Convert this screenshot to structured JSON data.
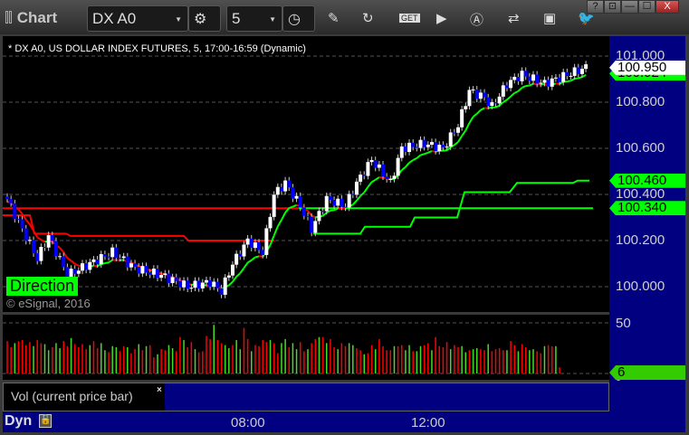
{
  "window": {
    "title": "Chart",
    "help": "?",
    "min": "—",
    "max": "☐",
    "close": "X"
  },
  "toolbar": {
    "symbol": "DX A0",
    "interval": "5",
    "icons": [
      "settings-icon",
      "clock-icon",
      "pencil-icon",
      "refresh-icon",
      "get-icon",
      "play-icon",
      "alert-icon",
      "link-icon",
      "comment-icon",
      "twitter-icon"
    ]
  },
  "chart": {
    "header": "* DX A0, US DOLLAR INDEX FUTURES, 5, 17:00-16:59 (Dynamic)",
    "direction_label": "Direction",
    "copyright": "© eSignal, 2016"
  },
  "price_axis": {
    "ticks": [
      "101.000",
      "100.800",
      "100.600",
      "100.400",
      "100.200",
      "100.000"
    ],
    "tags": {
      "last": "100.950",
      "ma": "100.924",
      "upper": "100.460",
      "lower": "100.340"
    }
  },
  "volume": {
    "ticks": [
      "50",
      "0"
    ],
    "last": "6",
    "label": "Vol (current price bar)",
    "close": "×"
  },
  "time_axis": {
    "ticks": [
      "08:00",
      "12:00"
    ],
    "mode": "Dyn"
  },
  "colors": {
    "up": "#ffffff",
    "down": "#0000ff",
    "green": "#00ff00",
    "red": "#ff0000",
    "axis": "#000080"
  },
  "chart_data": {
    "type": "candlestick",
    "ylim": [
      99.9,
      101.05
    ],
    "price_path": [
      [
        0,
        100.38
      ],
      [
        3,
        100.28
      ],
      [
        8,
        100.12
      ],
      [
        11,
        100.22
      ],
      [
        16,
        100.05
      ],
      [
        22,
        100.1
      ],
      [
        28,
        100.15
      ],
      [
        34,
        100.08
      ],
      [
        41,
        100.05
      ],
      [
        48,
        100.0
      ],
      [
        54,
        100.02
      ],
      [
        57,
        99.98
      ],
      [
        60,
        100.1
      ],
      [
        64,
        100.2
      ],
      [
        68,
        100.15
      ],
      [
        71,
        100.4
      ],
      [
        74,
        100.45
      ],
      [
        78,
        100.35
      ],
      [
        81,
        100.25
      ],
      [
        85,
        100.38
      ],
      [
        90,
        100.35
      ],
      [
        93,
        100.45
      ],
      [
        97,
        100.55
      ],
      [
        102,
        100.45
      ],
      [
        105,
        100.6
      ],
      [
        111,
        100.62
      ],
      [
        116,
        100.6
      ],
      [
        120,
        100.7
      ],
      [
        123,
        100.85
      ],
      [
        127,
        100.82
      ],
      [
        129,
        100.78
      ],
      [
        133,
        100.88
      ],
      [
        137,
        100.92
      ],
      [
        143,
        100.88
      ],
      [
        146,
        100.9
      ],
      [
        154,
        100.95
      ]
    ],
    "volumes": [
      32,
      26,
      30,
      32,
      33,
      28,
      31,
      27,
      33,
      30,
      29,
      23,
      26,
      30,
      25,
      32,
      27,
      35,
      29,
      26,
      29,
      24,
      28,
      32,
      25,
      30,
      23,
      21,
      27,
      26,
      22,
      27,
      26,
      20,
      24,
      29,
      23,
      27,
      28,
      16,
      19,
      24,
      23,
      28,
      25,
      22,
      36,
      33,
      26,
      31,
      24,
      21,
      22,
      37,
      34,
      48,
      33,
      30,
      28,
      25,
      28,
      33,
      24,
      45,
      34,
      22,
      28,
      27,
      33,
      31,
      33,
      30,
      20,
      30,
      34,
      26,
      30,
      24,
      31,
      22,
      24,
      30,
      34,
      36,
      36,
      30,
      34,
      26,
      24,
      30,
      27,
      30,
      28,
      25,
      23,
      19,
      20,
      28,
      24,
      34,
      27,
      23,
      23,
      27,
      27,
      28,
      23,
      28,
      22,
      22,
      27,
      28,
      30,
      23,
      36,
      27,
      26,
      31,
      24,
      28,
      26,
      27,
      21,
      23,
      24,
      25,
      24,
      23,
      29,
      22,
      24,
      25,
      23,
      23,
      32,
      28,
      22,
      29,
      26,
      23,
      24,
      22,
      20,
      27,
      28,
      27,
      27,
      6
    ]
  }
}
